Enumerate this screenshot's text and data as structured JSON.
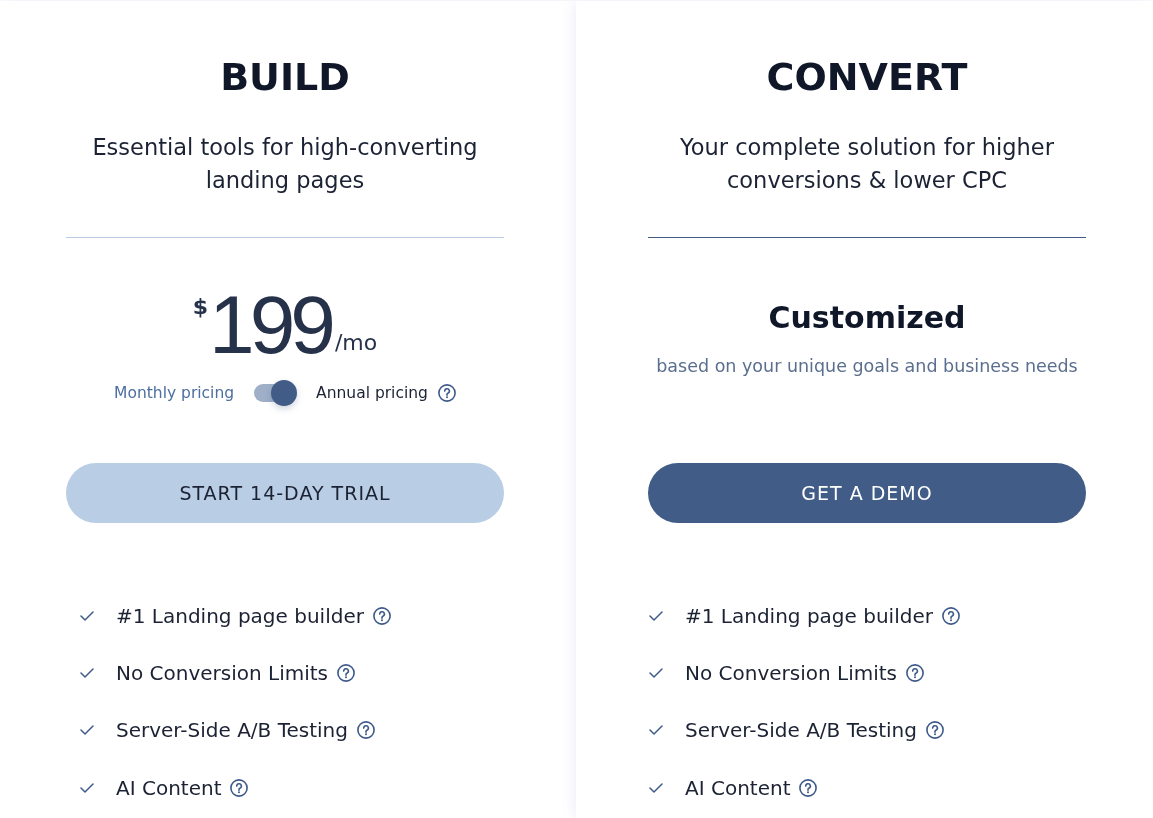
{
  "plans": [
    {
      "kind": "priced",
      "title": "BUILD",
      "subtitle": "Essential tools for high-converting landing pages",
      "price": {
        "currency": "$",
        "amount": "199",
        "period": "/mo"
      },
      "billing": {
        "left_label": "Monthly pricing",
        "right_label": "Annual pricing",
        "on": true
      },
      "button": {
        "label": "START 14-DAY TRIAL",
        "primary": false
      },
      "features": [
        {
          "label": "#1 Landing page builder",
          "included": true
        },
        {
          "label": "No Conversion Limits",
          "included": true
        },
        {
          "label": "Server-Side A/B Testing",
          "included": true
        },
        {
          "label": "AI Content",
          "included": true
        }
      ]
    },
    {
      "kind": "custom",
      "title": "CONVERT",
      "subtitle": "Your complete solution for higher conversions & lower CPC",
      "custom_price": {
        "heading": "Customized",
        "note": "based on your unique goals and business needs"
      },
      "button": {
        "label": "GET A DEMO",
        "primary": true
      },
      "features": [
        {
          "label": "#1 Landing page builder",
          "included": true
        },
        {
          "label": "No Conversion Limits",
          "included": true
        },
        {
          "label": "Server-Side A/B Testing",
          "included": true
        },
        {
          "label": "AI Content",
          "included": true
        }
      ]
    }
  ]
}
